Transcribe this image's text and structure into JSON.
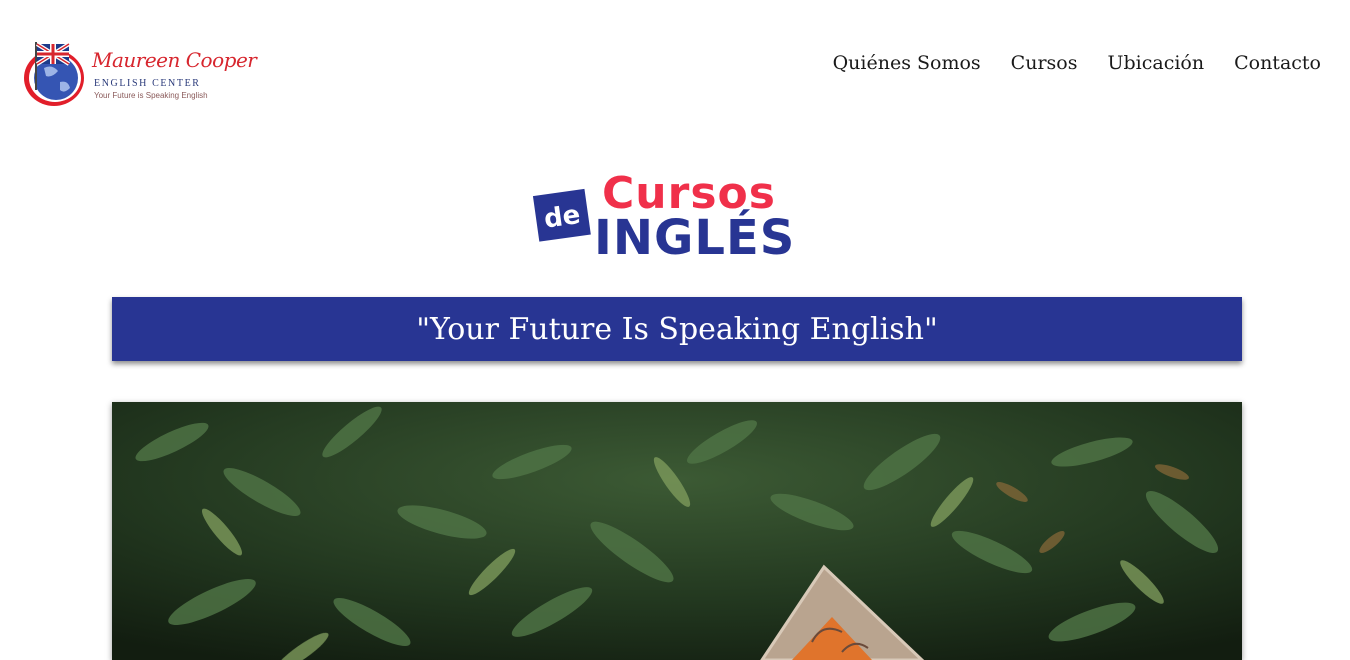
{
  "logo": {
    "name": "Maureen Cooper",
    "center": "ENGLISH CENTER",
    "tagline": "Your Future is Speaking English"
  },
  "nav": {
    "items": [
      "Quiénes Somos",
      "Cursos",
      "Ubicación",
      "Contacto"
    ]
  },
  "heading_logo": {
    "word_top": "Cursos",
    "word_badge": "de",
    "word_bottom": "INGLÉS"
  },
  "banner": {
    "text": "\"Your Future Is Speaking English\""
  },
  "hero": {
    "icon": "foliage-photo"
  },
  "colors": {
    "brand_blue": "#283593",
    "brand_red": "#f0304a",
    "logo_red": "#d7262e",
    "nav_text": "#1a1a1a",
    "banner_text": "#ffffff"
  }
}
